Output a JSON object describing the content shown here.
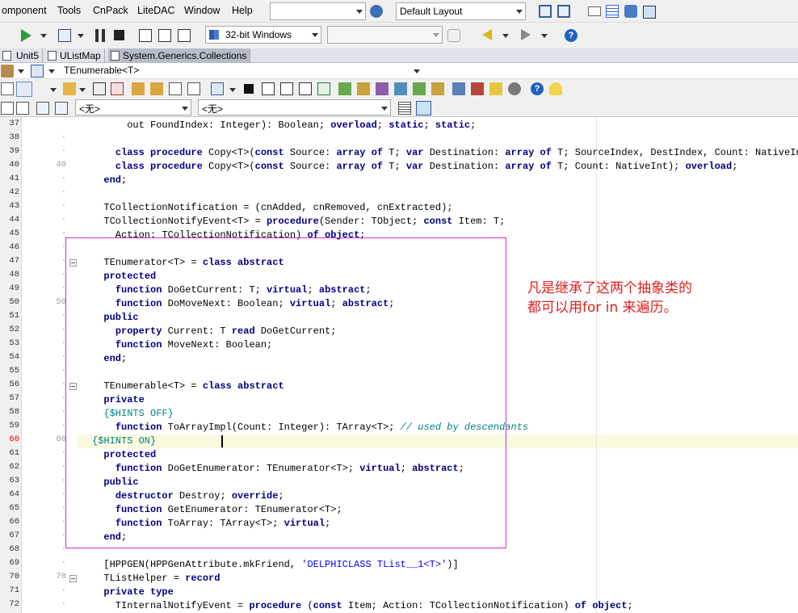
{
  "menu": [
    "omponent",
    "Tools",
    "CnPack",
    "LiteDAC",
    "Window",
    "Help"
  ],
  "layout_combo": "Default Layout",
  "platform_combo": "32-bit Windows",
  "tabs": [
    {
      "label": "Unit5"
    },
    {
      "label": "UListMap"
    },
    {
      "label": "System.Generics.Collections",
      "active": true
    }
  ],
  "class_selector": "TEnumerable<T>",
  "scope_combo_1": "<无>",
  "scope_combo_2": "<无>",
  "colors": {
    "annotation_box": "#d22bd2",
    "annotation_text": "#e02020",
    "keyword": "#000080",
    "directive": "#008080",
    "string": "#0000ff"
  },
  "annotation": {
    "line1": "凡是继承了这两个抽象类的",
    "line2": "都可以用for in 来遍历。"
  },
  "current_line": 60,
  "lines": [
    {
      "n": "37",
      "mark": "",
      "html": "      out FoundIndex: Integer): Boolean; <k>overload</k>; <k>static</k>; <k>static</k>;"
    },
    {
      "n": "38",
      "mark": "·",
      "html": ""
    },
    {
      "n": "39",
      "mark": "·",
      "html": "    <k>class procedure</k> Copy&lt;T&gt;(<k>const</k> Source: <k>array of</k> T; <k>var</k> Destination: <k>array of</k> T; SourceIndex, DestIndex, Count: NativeInt); <k>overload</k>;"
    },
    {
      "n": "40",
      "mark": "40",
      "html": "    <k>class procedure</k> Copy&lt;T&gt;(<k>const</k> Source: <k>array of</k> T; <k>var</k> Destination: <k>array of</k> T; Count: NativeInt); <k>overload</k>;"
    },
    {
      "n": "41",
      "mark": "·",
      "html": "  <k>end</k>;"
    },
    {
      "n": "42",
      "mark": "·",
      "html": ""
    },
    {
      "n": "43",
      "mark": "·",
      "html": "  TCollectionNotification = (cnAdded, cnRemoved, cnExtracted);"
    },
    {
      "n": "44",
      "mark": "·",
      "html": "  TCollectionNotifyEvent&lt;T&gt; = <k>procedure</k>(Sender: TObject; <k>const</k> Item: T;"
    },
    {
      "n": "45",
      "mark": "·",
      "html": "    Action: TCollectionNotification) <k>of object</k>;"
    },
    {
      "n": "46",
      "mark": "·",
      "html": ""
    },
    {
      "n": "47",
      "mark": "·",
      "html": "  TEnumerator&lt;T&gt; = <k>class abstract</k>",
      "fold": true
    },
    {
      "n": "48",
      "mark": "·",
      "html": "  <k>protected</k>"
    },
    {
      "n": "49",
      "mark": "·",
      "html": "    <k>function</k> DoGetCurrent: T; <k>virtual</k>; <k>abstract</k>;"
    },
    {
      "n": "50",
      "mark": "50",
      "html": "    <k>function</k> DoMoveNext: Boolean; <k>virtual</k>; <k>abstract</k>;"
    },
    {
      "n": "51",
      "mark": "·",
      "html": "  <k>public</k>"
    },
    {
      "n": "52",
      "mark": "·",
      "html": "    <k>property</k> Current: T <k>read</k> DoGetCurrent;"
    },
    {
      "n": "53",
      "mark": "·",
      "html": "    <k>function</k> MoveNext: Boolean;"
    },
    {
      "n": "54",
      "mark": "·",
      "html": "  <k>end</k>;"
    },
    {
      "n": "55",
      "mark": "·",
      "html": ""
    },
    {
      "n": "56",
      "mark": "·",
      "html": "  TEnumerable&lt;T&gt; = <k>class abstract</k>",
      "fold": true
    },
    {
      "n": "57",
      "mark": "·",
      "html": "  <k>private</k>"
    },
    {
      "n": "58",
      "mark": "·",
      "html": "  <d>{$HINTS OFF}</d>"
    },
    {
      "n": "59",
      "mark": "·",
      "html": "    <k>function</k> ToArrayImpl(Count: Integer): TArray&lt;T&gt;; <c>// used by descendants</c>"
    },
    {
      "n": "60",
      "mark": "60",
      "html": "<d>{$HINTS ON}</d>"
    },
    {
      "n": "61",
      "mark": "·",
      "html": "  <k>protected</k>"
    },
    {
      "n": "62",
      "mark": "·",
      "html": "    <k>function</k> DoGetEnumerator: TEnumerator&lt;T&gt;; <k>virtual</k>; <k>abstract</k>;"
    },
    {
      "n": "63",
      "mark": "·",
      "html": "  <k>public</k>"
    },
    {
      "n": "64",
      "mark": "·",
      "html": "    <k>destructor</k> Destroy; <k>override</k>;"
    },
    {
      "n": "65",
      "mark": "·",
      "html": "    <k>function</k> GetEnumerator: TEnumerator&lt;T&gt;;"
    },
    {
      "n": "66",
      "mark": "·",
      "html": "    <k>function</k> ToArray: TArray&lt;T&gt;; <k>virtual</k>;"
    },
    {
      "n": "67",
      "mark": "·",
      "html": "  <k>end</k>;"
    },
    {
      "n": "68",
      "mark": "·",
      "html": ""
    },
    {
      "n": "69",
      "mark": "·",
      "html": "  [HPPGEN(HPPGenAttribute.mkFriend, <s>'DELPHICLASS TList__1&lt;T&gt;'</s>)]"
    },
    {
      "n": "70",
      "mark": "70",
      "html": "  TListHelper = <k>record</k>",
      "fold": true
    },
    {
      "n": "71",
      "mark": "·",
      "html": "  <k>private type</k>"
    },
    {
      "n": "72",
      "mark": "·",
      "html": "    TInternalNotifyEvent = <k>procedure</k> (<k>const</k> Item; Action: TCollectionNotification) <k>of object</k>;"
    }
  ]
}
